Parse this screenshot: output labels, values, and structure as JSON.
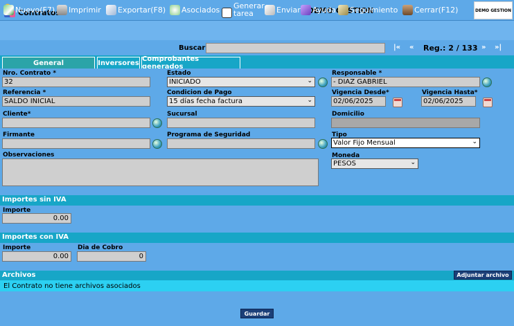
{
  "header": {
    "title": "Contratos",
    "company": "DEMO GESTION",
    "logo_text": "DEMO GESTION"
  },
  "toolbar": {
    "nuevo": "Nuevo(F7)",
    "imprimir": "Imprimir",
    "exportar": "Exportar(F8)",
    "asociados": "Asociados",
    "generar_line1": "Generar",
    "generar_line2": "tarea",
    "enviar": "Enviar",
    "ayuda": "Ayuda",
    "seguimiento": "Seguimiento",
    "cerrar": "Cerrar(F12)"
  },
  "search": {
    "label": "Buscar",
    "value": ""
  },
  "nav": {
    "first": "|«",
    "prev": "«",
    "next": "»",
    "last": "»|",
    "record_label": "Reg.:",
    "record_value": "2 / 133"
  },
  "tabs": {
    "general": "General",
    "inversores": "Inversores",
    "comprobantes": "Comprobantes generados"
  },
  "form": {
    "nro_contrato": {
      "label": "Nro. Contrato *",
      "value": "32"
    },
    "estado": {
      "label": "Estado",
      "value": "INICIADO"
    },
    "responsable": {
      "label": "Responsable *",
      "value": "- DIAZ GABRIEL"
    },
    "referencia": {
      "label": "Referencia *",
      "value": "SALDO INICIAL"
    },
    "condicion_pago": {
      "label": "Condicion de Pago",
      "value": "15 días fecha factura"
    },
    "vigencia_desde": {
      "label": "Vigencia Desde*",
      "value": "02/06/2025"
    },
    "vigencia_hasta": {
      "label": "Vigencia Hasta*",
      "value": "02/06/2025"
    },
    "cliente": {
      "label": "Cliente*",
      "value": ""
    },
    "sucursal": {
      "label": "Sucursal",
      "value": ""
    },
    "domicilio": {
      "label": "Domicilio",
      "value": ""
    },
    "firmante": {
      "label": "Firmante",
      "value": ""
    },
    "programa_seguridad": {
      "label": "Programa de Seguridad",
      "value": ""
    },
    "tipo": {
      "label": "Tipo",
      "value": "Valor Fijo Mensual"
    },
    "observaciones": {
      "label": "Observaciones",
      "value": ""
    },
    "moneda": {
      "label": "Moneda",
      "value": "PESOS"
    }
  },
  "importes_sin_iva": {
    "title": "Importes sin IVA",
    "importe_label": "Importe",
    "importe_value": "0.00"
  },
  "importes_con_iva": {
    "title": "Importes con IVA",
    "importe_label": "Importe",
    "importe_value": "0.00",
    "dia_cobro_label": "Dia de Cobro",
    "dia_cobro_value": "0"
  },
  "archivos": {
    "title": "Archivos",
    "adjuntar": "Adjuntar archivo",
    "empty_message": "El Contrato no tiene archivos asociados"
  },
  "footer": {
    "guardar": "Guardar"
  },
  "colors": {
    "background": "#5ea9e8",
    "section_band": "#17a6c7",
    "active_tab": "#2ba4a8",
    "button_dark": "#1b3f78",
    "message_band": "#2cd0f2"
  }
}
